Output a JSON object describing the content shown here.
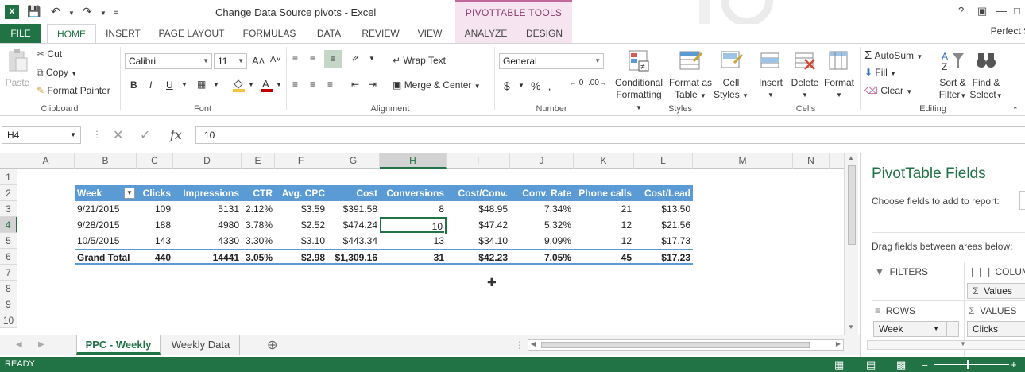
{
  "title_bar": {
    "doc_title": "Change Data Source pivots - Excel",
    "context_tools": "PIVOTTABLE TOOLS",
    "user": "Perfect S",
    "help": "?"
  },
  "tabs": {
    "file": "FILE",
    "items": [
      "HOME",
      "INSERT",
      "PAGE LAYOUT",
      "FORMULAS",
      "DATA",
      "REVIEW",
      "VIEW"
    ],
    "context": [
      "ANALYZE",
      "DESIGN"
    ]
  },
  "ribbon": {
    "clipboard": {
      "paste": "Paste",
      "cut": "Cut",
      "copy": "Copy",
      "format_painter": "Format Painter",
      "label": "Clipboard"
    },
    "font": {
      "name": "Calibri",
      "size": "11",
      "label": "Font",
      "bold": "B",
      "italic": "I",
      "underline": "U"
    },
    "alignment": {
      "wrap": "Wrap Text",
      "merge": "Merge & Center",
      "label": "Alignment"
    },
    "number": {
      "format": "General",
      "label": "Number",
      "currency": "$",
      "percent": "%"
    },
    "styles": {
      "conditional": "Conditional",
      "conditional2": "Formatting",
      "format_as": "Format as",
      "format_as2": "Table",
      "cell": "Cell",
      "cell2": "Styles",
      "label": "Styles"
    },
    "cells": {
      "insert": "Insert",
      "delete": "Delete",
      "format": "Format",
      "label": "Cells"
    },
    "editing": {
      "autosum": "AutoSum",
      "fill": "Fill",
      "clear": "Clear",
      "sort": "Sort &",
      "sort2": "Filter",
      "find": "Find &",
      "find2": "Select",
      "label": "Editing"
    }
  },
  "formula_bar": {
    "name_box": "H4",
    "value": "10",
    "fx": "fx"
  },
  "columns": [
    "A",
    "B",
    "C",
    "D",
    "E",
    "F",
    "G",
    "H",
    "I",
    "J",
    "K",
    "L",
    "M",
    "N"
  ],
  "rows": [
    "1",
    "2",
    "3",
    "4",
    "5",
    "6",
    "7",
    "8",
    "9",
    "10"
  ],
  "table": {
    "headers": [
      "Week",
      "Clicks",
      "Impressions",
      "CTR",
      "Avg. CPC",
      "Cost",
      "Conversions",
      "Cost/Conv.",
      "Conv. Rate",
      "Phone calls",
      "Cost/Lead"
    ],
    "rows": [
      [
        "9/21/2015",
        "109",
        "5131",
        "2.12%",
        "$3.59",
        "$391.58",
        "8",
        "$48.95",
        "7.34%",
        "21",
        "$13.50"
      ],
      [
        "9/28/2015",
        "188",
        "4980",
        "3.78%",
        "$2.52",
        "$474.24",
        "10",
        "$47.42",
        "5.32%",
        "12",
        "$21.56"
      ],
      [
        "10/5/2015",
        "143",
        "4330",
        "3.30%",
        "$3.10",
        "$443.34",
        "13",
        "$34.10",
        "9.09%",
        "12",
        "$17.73"
      ]
    ],
    "total": [
      "Grand Total",
      "440",
      "14441",
      "3.05%",
      "$2.98",
      "$1,309.16",
      "31",
      "$42.23",
      "7.05%",
      "45",
      "$17.23"
    ]
  },
  "sheets": {
    "active": "PPC - Weekly",
    "other": "Weekly Data"
  },
  "status": "READY",
  "pivot_pane": {
    "title": "PivotTable Fields",
    "choose": "Choose fields to add to report:",
    "drag": "Drag fields between areas below:",
    "filters": "FILTERS",
    "columns": "COLUMN",
    "columns_item": "Values",
    "rows": "ROWS",
    "values": "VALUES",
    "rows_item": "Week",
    "values_item": "Clicks"
  }
}
